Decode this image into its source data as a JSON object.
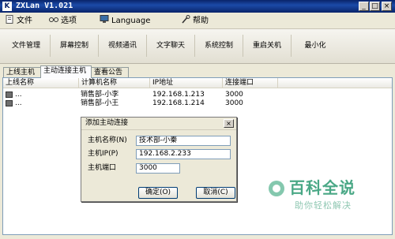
{
  "window": {
    "title": "ZXLan V1.021",
    "icon_letter": "K"
  },
  "titlebar_buttons": {
    "minimize": "_",
    "maximize": "□",
    "close": "×"
  },
  "menu": [
    {
      "label": "文件",
      "icon": "document-icon"
    },
    {
      "label": "选项",
      "icon": "glasses-icon"
    },
    {
      "label": "Language",
      "icon": "monitor-icon"
    },
    {
      "label": "帮助",
      "icon": "wrench-icon"
    }
  ],
  "toolbar": [
    "文件管理",
    "屏幕控制",
    "视频通讯",
    "文字聊天",
    "系统控制",
    "重启关机",
    "最小化"
  ],
  "tabs": [
    {
      "label": "上线主机",
      "active": false
    },
    {
      "label": "主动连接主机",
      "active": true
    },
    {
      "label": "查看公告",
      "active": false
    }
  ],
  "list": {
    "columns": [
      "上线名称",
      "计算机名称",
      "IP地址",
      "连接端口"
    ],
    "rows": [
      {
        "online_name": "...",
        "computer_name": "销售部-小李",
        "ip": "192.168.1.213",
        "port": "3000"
      },
      {
        "online_name": "...",
        "computer_name": "销售部-小王",
        "ip": "192.168.1.214",
        "port": "3000"
      }
    ]
  },
  "dialog": {
    "title": "添加主动连接",
    "close": "×",
    "host_name_label": "主机名称(N)",
    "host_name_value": "技术部-小秦",
    "host_ip_label": "主机IP(P)",
    "host_ip_value": "192.168.2.233",
    "host_port_label": "主机端口",
    "host_port_value": "3000",
    "ok_label": "确定(O)",
    "cancel_label": "取消(C)"
  },
  "watermark": {
    "text": "百科全说",
    "subtitle": "助你轻松解决"
  },
  "colors": {
    "titlebar": "#0a246a",
    "window_bg": "#ece9d8",
    "watermark": "#4aa886"
  }
}
